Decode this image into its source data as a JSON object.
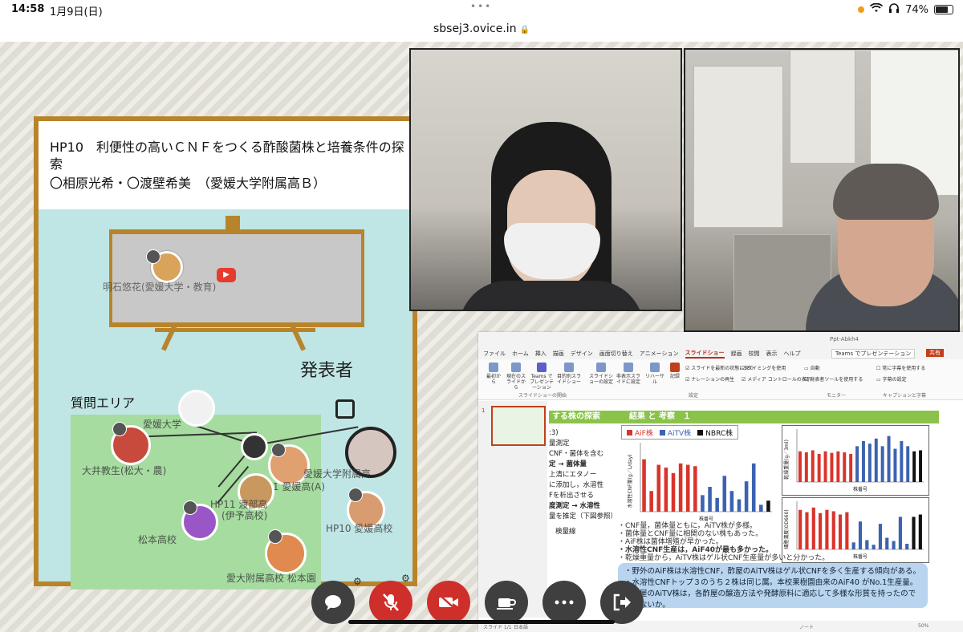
{
  "status_bar": {
    "time": "14:58",
    "date": "1月9日(日)",
    "battery": "74%"
  },
  "browser": {
    "url": "sbsej3.ovice.in"
  },
  "poster": {
    "title": "HP10　利便性の高いＣＮＦをつくる酢酸菌株と培養条件の探索",
    "authors": "〇相原光希・〇渡壁希美　（愛媛大学附属高Ｂ）",
    "board_user": "明石悠花(愛媛大学・教育)",
    "qa_label": "質問エリア",
    "speaker_label": "発表者"
  },
  "avatars": [
    {
      "label": "愛媛大学"
    },
    {
      "label": "大井教生(松大・農)"
    },
    {
      "label": "愛媛大学附属高"
    },
    {
      "label": "HP11 愛媛高(A)"
    },
    {
      "label": "HP11 渡部高"
    },
    {
      "label": "(伊予高校)"
    },
    {
      "label": "松本高校"
    },
    {
      "label": "HP10 愛媛高校"
    },
    {
      "label": "愛大附属高校 松本園"
    }
  ],
  "ppt": {
    "file_name": "Ppt-Abkh4",
    "tabs": [
      "ファイル",
      "ホーム",
      "挿入",
      "描画",
      "デザイン",
      "画面切り替え",
      "アニメーション",
      "スライドショー",
      "録画",
      "校閲",
      "表示",
      "ヘルプ"
    ],
    "active_tab": "スライドショー",
    "teams_label": "Teams でプレゼンテーション",
    "share_label": "共有",
    "ribbon": {
      "b1": "最初から",
      "b2": "現在のスライドから",
      "b3": "Teams でプレゼンテーション",
      "b4": "目的別スライドショー",
      "b5": "スライドショーの設定",
      "b6": "非表示スライドに設定",
      "b7": "リハーサル",
      "b8": "記録",
      "c1": "スライドを最新の状態に保つ",
      "c2": "ナレーションの再生",
      "c3": "タイミングを使用",
      "c4": "メディア コントロールの表示",
      "m1": "自動",
      "m2": "発表者ツールを使用する",
      "s1": "常に字幕を使用する",
      "s2": "字幕の設定",
      "g1": "スライドショーの開始",
      "g2": "設定",
      "g3": "モニター",
      "g4": "キャプションと字幕"
    },
    "slide_number": "1",
    "left_heading": "する株の探索",
    "left_lines": [
      ":3)",
      "量測定",
      "CNF・菌体を含む",
      "",
      "定 → 菌体量",
      "",
      "上清にエタノー",
      "に添加し，水溶性",
      "Fを析出させる",
      "",
      "度測定 → 水溶性",
      "量を推定（下図参照）",
      "",
      "検量線"
    ],
    "right_heading": "結果 と 考察　１",
    "legend": {
      "a": "AiF株",
      "b": "AiTV株",
      "c": "NBRC株"
    },
    "y_label_main": "水溶性CNF量(g／L/day)",
    "x_label": "株番号",
    "y_label_dry": "乾燥重量(g／3ml)",
    "y_label_od": "細胞濃度(OD660)",
    "bullets": [
      "・CNF量，菌体量ともに，AiTV株が多様。",
      "・菌体量とCNF量に相関のない株もあった。",
      "・AiF株は菌体増殖が早かった。",
      "・水溶性CNF生産は，AiF40が最も多かった。",
      "・乾燥重量から，AiTV株はゲル状CNF生産量が多いと分かった。"
    ],
    "summary": [
      "・野外のAiF株は水溶性CNF，酢屋のAiTV株はゲル状CNFを多く生産する傾向がある。",
      "・水溶性CNFトップ３のうち２株は同じ属。本校果樹園由来のAiF40 がNo.1生産量。",
      "・酢屋のAiTV株は，各酢屋の醸造方法や発酵原料に適応して多様な形質を持ったので",
      "　はないか。"
    ],
    "status": {
      "slide": "スライド 1/1",
      "lang": "日本語",
      "zoom": "50%",
      "notes": "ノート"
    },
    "colors": {
      "red": "#d9342b",
      "blue": "#3c62b0",
      "black": "#111111"
    }
  },
  "chart_data": [
    {
      "type": "bar",
      "title": "",
      "ylabel": "水溶性CNF量(g／L/day)",
      "xlabel": "株番号",
      "ylim": [
        0,
        0.5
      ],
      "series": [
        {
          "name": "AiF株",
          "color": "#d9342b",
          "values": [
            0.38,
            0.15,
            0.34,
            0.32,
            0.28,
            0.35,
            0.34,
            0.33
          ]
        },
        {
          "name": "AiTV株",
          "color": "#3c62b0",
          "values": [
            0.12,
            0.18,
            0.1,
            0.26,
            0.15,
            0.09,
            0.22,
            0.35,
            0.05
          ]
        },
        {
          "name": "NBRC株",
          "color": "#111111",
          "values": [
            0.08
          ]
        }
      ]
    },
    {
      "type": "bar",
      "ylabel": "乾燥重量(g／3ml)",
      "xlabel": "株番号",
      "series": [
        {
          "name": "AiF株",
          "color": "#d9342b",
          "values": [
            0.6,
            0.58,
            0.62,
            0.55,
            0.6,
            0.57,
            0.6,
            0.58,
            0.55
          ]
        },
        {
          "name": "AiTV株",
          "color": "#3c62b0",
          "values": [
            0.7,
            0.8,
            0.75,
            0.85,
            0.7,
            0.9,
            0.65,
            0.8,
            0.7
          ]
        },
        {
          "name": "NBRC株",
          "color": "#111111",
          "values": [
            0.6,
            0.62
          ]
        }
      ]
    },
    {
      "type": "bar",
      "ylabel": "細胞濃度(OD660)",
      "xlabel": "株番号",
      "series": [
        {
          "name": "AiF株",
          "color": "#d9342b",
          "values": [
            0.85,
            0.8,
            0.9,
            0.78,
            0.85,
            0.82,
            0.75,
            0.8
          ]
        },
        {
          "name": "AiTV株",
          "color": "#3c62b0",
          "values": [
            0.15,
            0.6,
            0.2,
            0.1,
            0.55,
            0.25,
            0.18,
            0.7,
            0.12
          ]
        },
        {
          "name": "NBRC株",
          "color": "#111111",
          "values": [
            0.7,
            0.75
          ]
        }
      ]
    }
  ],
  "toolbar": {
    "chat": "chat-icon",
    "mic": "mic-off-icon",
    "camera": "camera-off-icon",
    "coffee": "coffee-icon",
    "more": "more-icon",
    "leave": "leave-icon"
  }
}
